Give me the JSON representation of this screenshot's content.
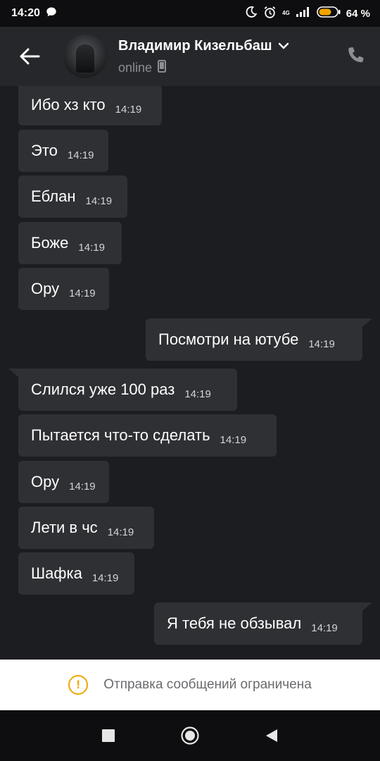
{
  "status_bar": {
    "time": "14:20",
    "network": "4G",
    "battery": "64 %",
    "icons": [
      "chat-bubble-icon",
      "moon-icon",
      "alarm-icon",
      "signal-icon",
      "battery-icon"
    ]
  },
  "header": {
    "contact_name": "Владимир Кизельбаш",
    "status": "online",
    "icons": [
      "back-arrow-icon",
      "chevron-down-icon",
      "mobile-device-icon",
      "phone-icon"
    ]
  },
  "messages": [
    {
      "text": "Ибо хз кто",
      "time": "14:19",
      "side": "incoming"
    },
    {
      "text": "Это",
      "time": "14:19",
      "side": "incoming"
    },
    {
      "text": "Еблан",
      "time": "14:19",
      "side": "incoming"
    },
    {
      "text": "Боже",
      "time": "14:19",
      "side": "incoming"
    },
    {
      "text": "Ору",
      "time": "14:19",
      "side": "incoming"
    },
    {
      "text": "Посмотри на ютубе",
      "time": "14:19",
      "side": "outgoing"
    },
    {
      "text": "Слился уже 100 раз",
      "time": "14:19",
      "side": "incoming"
    },
    {
      "text": "Пытается что-то сделать",
      "time": "14:19",
      "side": "incoming"
    },
    {
      "text": "Ору",
      "time": "14:19",
      "side": "incoming"
    },
    {
      "text": "Лети в чс",
      "time": "14:19",
      "side": "incoming"
    },
    {
      "text": "Шафка",
      "time": "14:19",
      "side": "incoming"
    },
    {
      "text": "Я тебя не обзывал",
      "time": "14:19",
      "side": "outgoing"
    }
  ],
  "footer": {
    "restricted_text": "Отправка сообщений ограничена",
    "icon": "warning-icon",
    "accent_color": "#f0a500"
  },
  "nav_bar": {
    "icons": [
      "recent-apps-icon",
      "home-icon",
      "back-icon"
    ]
  }
}
